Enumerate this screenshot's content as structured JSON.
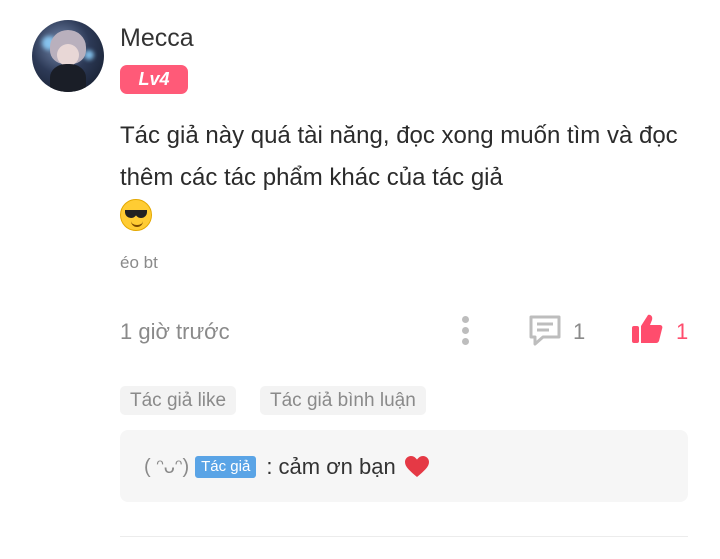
{
  "comment": {
    "username": "Mecca",
    "level": "Lv4",
    "text": "Tác giả này quá tài năng, đọc xong muốn tìm và đọc thêm các tác phẩm khác của tác giả",
    "emoji": "sunglasses-emoji",
    "subtext": "éo bt",
    "timestamp": "1 giờ trước",
    "reply_count": "1",
    "like_count": "1"
  },
  "tags": [
    "Tác giả like",
    "Tác giả bình luận"
  ],
  "reply": {
    "name": "( ᵔᴗᵔ)",
    "badge": "Tác giả",
    "text": ": cảm ơn bạn",
    "emoji": "red-heart-emoji"
  },
  "colors": {
    "level_badge": "#ff5a78",
    "like": "#ff4d6d",
    "author_badge": "#5aa4e6",
    "muted_text": "#8a8a8a"
  },
  "icons": [
    "more-vertical-icon",
    "comment-icon",
    "thumbs-up-icon"
  ]
}
